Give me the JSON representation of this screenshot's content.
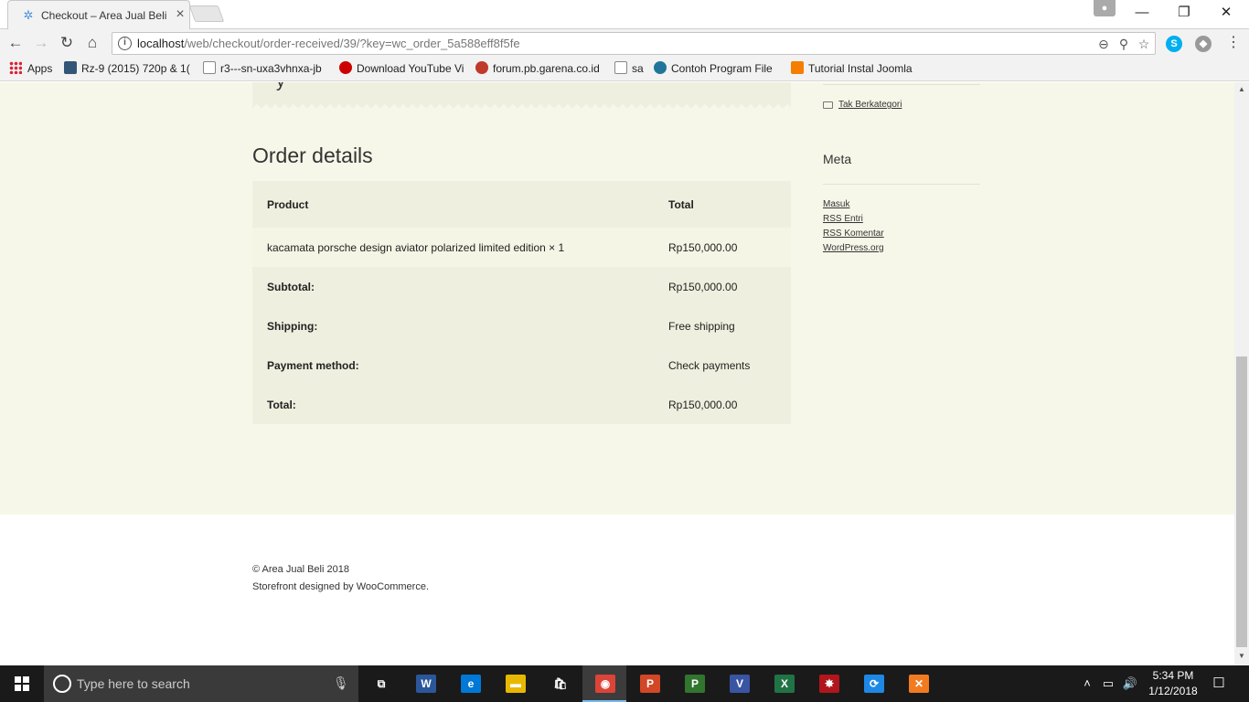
{
  "browser": {
    "tab": {
      "title": "Checkout – Area Jual Beli",
      "close_glyph": "×"
    },
    "window_controls": {
      "minimize": "—",
      "restore": "❐",
      "close": "✕"
    },
    "url": {
      "host": "localhost",
      "path": "/web/checkout/order-received/39/?key=wc_order_5a588eff8f5fe"
    },
    "bookmarks": [
      {
        "label": "Apps",
        "icon": "apps-grid-icon",
        "color": "#d23"
      },
      {
        "label": "Rz-9 (2015) 720p & 1(",
        "icon": "site-icon",
        "color": "#335577"
      },
      {
        "label": "r3---sn-uxa3vhnxa-jb",
        "icon": "page-icon",
        "color": "#888888"
      },
      {
        "label": "Download YouTube Vi",
        "icon": "youtube-icon",
        "color": "#cc0000"
      },
      {
        "label": "forum.pb.garena.co.id",
        "icon": "garena-icon",
        "color": "#c0392b"
      },
      {
        "label": "sa",
        "icon": "page-icon",
        "color": "#888888"
      },
      {
        "label": "Contoh Program File",
        "icon": "wordpress-icon",
        "color": "#21759b"
      },
      {
        "label": "Tutorial Instal Joomla",
        "icon": "blogger-icon",
        "color": "#f57d00"
      }
    ]
  },
  "page": {
    "notice_fragment": "y",
    "order_details": {
      "title": "Order details",
      "header": {
        "product": "Product",
        "total": "Total"
      },
      "items": [
        {
          "product": "kacamata porsche design aviator polarized limited edition × 1",
          "total": "Rp150,000.00"
        }
      ],
      "totals": [
        {
          "label": "Subtotal:",
          "value": "Rp150,000.00"
        },
        {
          "label": "Shipping:",
          "value": "Free shipping"
        },
        {
          "label": "Payment method:",
          "value": "Check payments"
        },
        {
          "label": "Total:",
          "value": "Rp150,000.00"
        }
      ]
    },
    "sidebar": {
      "category_link": "Tak Berkategori",
      "meta_title": "Meta",
      "meta_links": [
        "Masuk",
        "RSS Entri",
        "RSS Komentar",
        "WordPress.org"
      ]
    },
    "footer": {
      "copyright": "© Area Jual Beli 2018",
      "credit": "Storefront designed by WooCommerce."
    }
  },
  "taskbar": {
    "search_placeholder": "Type here to search",
    "apps": [
      {
        "name": "task-view",
        "glyph": "⧉",
        "color": "#1a1a1a"
      },
      {
        "name": "word",
        "glyph": "W",
        "color": "#2b579a"
      },
      {
        "name": "edge",
        "glyph": "e",
        "color": "#0078d7"
      },
      {
        "name": "file-explorer",
        "glyph": "▬",
        "color": "#e8b800"
      },
      {
        "name": "store",
        "glyph": "🛍",
        "color": "#1a1a1a"
      },
      {
        "name": "chrome",
        "glyph": "◉",
        "color": "#db4437"
      },
      {
        "name": "powerpoint",
        "glyph": "P",
        "color": "#d24726"
      },
      {
        "name": "project",
        "glyph": "P",
        "color": "#31752f"
      },
      {
        "name": "visio",
        "glyph": "V",
        "color": "#3955a3"
      },
      {
        "name": "excel",
        "glyph": "X",
        "color": "#217346"
      },
      {
        "name": "unknown-red",
        "glyph": "✸",
        "color": "#b0161b"
      },
      {
        "name": "sync",
        "glyph": "⟳",
        "color": "#1e88e5"
      },
      {
        "name": "xampp",
        "glyph": "✕",
        "color": "#f27b20"
      }
    ],
    "clock": {
      "time": "5:34 PM",
      "date": "1/12/2018"
    }
  }
}
